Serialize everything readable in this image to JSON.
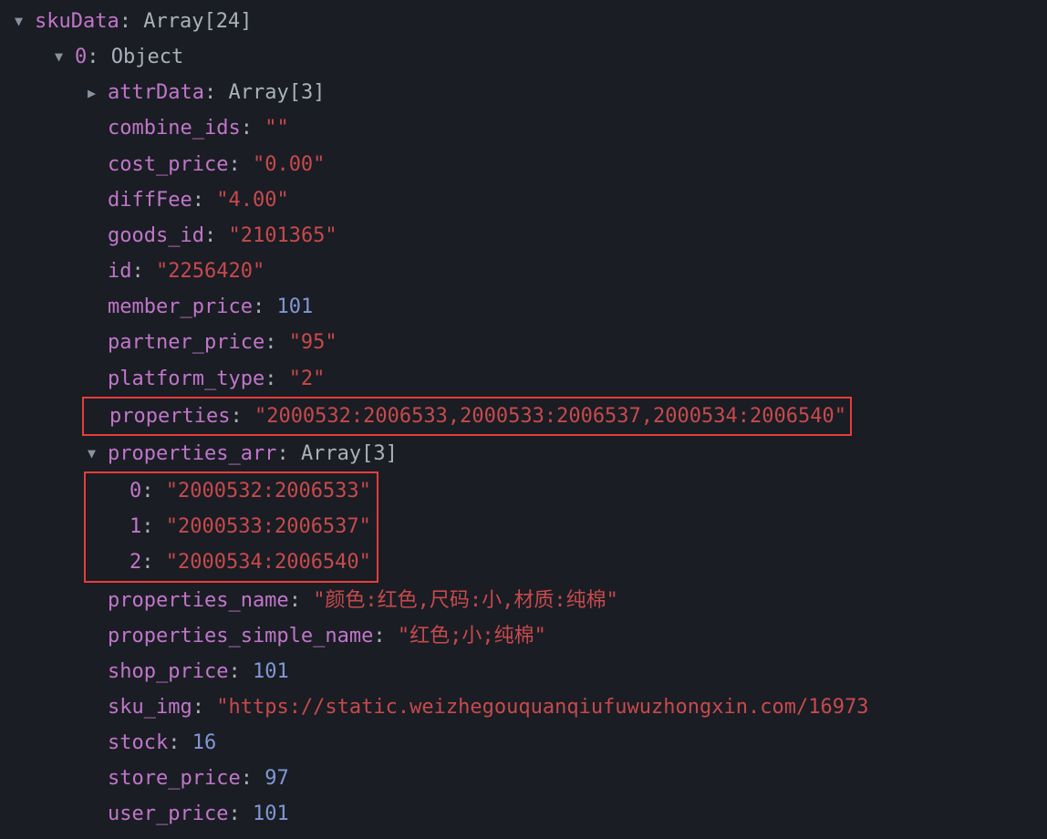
{
  "root": {
    "key": "skuData",
    "type": "Array[24]"
  },
  "item0": {
    "key": "0",
    "type": "Object"
  },
  "attrData": {
    "key": "attrData",
    "type": "Array[3]"
  },
  "combine_ids": {
    "key": "combine_ids",
    "value": "\"\""
  },
  "cost_price": {
    "key": "cost_price",
    "value": "\"0.00\""
  },
  "diffFee": {
    "key": "diffFee",
    "value": "\"4.00\""
  },
  "goods_id": {
    "key": "goods_id",
    "value": "\"2101365\""
  },
  "id": {
    "key": "id",
    "value": "\"2256420\""
  },
  "member_price": {
    "key": "member_price",
    "value": "101"
  },
  "partner_price": {
    "key": "partner_price",
    "value": "\"95\""
  },
  "platform_type": {
    "key": "platform_type",
    "value": "\"2\""
  },
  "properties": {
    "key": "properties",
    "value": "\"2000532:2006533,2000533:2006537,2000534:2006540\""
  },
  "properties_arr": {
    "key": "properties_arr",
    "type": "Array[3]"
  },
  "pa0": {
    "key": "0",
    "value": "\"2000532:2006533\""
  },
  "pa1": {
    "key": "1",
    "value": "\"2000533:2006537\""
  },
  "pa2": {
    "key": "2",
    "value": "\"2000534:2006540\""
  },
  "properties_name": {
    "key": "properties_name",
    "value": "\"颜色:红色,尺码:小,材质:纯棉\""
  },
  "properties_simple_name": {
    "key": "properties_simple_name",
    "value": "\"红色;小;纯棉\""
  },
  "shop_price": {
    "key": "shop_price",
    "value": "101"
  },
  "sku_img": {
    "key": "sku_img",
    "value": "\"https://static.weizhegouquanqiufuwuzhongxin.com/16973"
  },
  "stock": {
    "key": "stock",
    "value": "16"
  },
  "store_price": {
    "key": "store_price",
    "value": "97"
  },
  "user_price": {
    "key": "user_price",
    "value": "101"
  }
}
